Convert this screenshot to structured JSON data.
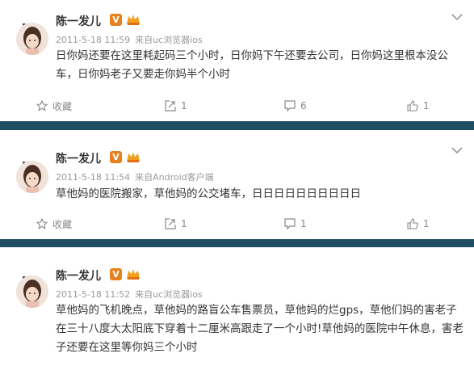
{
  "posts": [
    {
      "author": "陈一发儿",
      "verified_badge": "V",
      "time": "2011-5-18 11:59",
      "source_prefix": "来自",
      "source": "uc浏览器ios",
      "content": "日你妈还要在这里耗起码三个小时，日你妈下午还要去公司，日你妈这里根本没公车，日你妈老子又要走你妈半个小时",
      "favorite_label": "收藏",
      "repost_count": "1",
      "comment_count": "6",
      "like_count": "1"
    },
    {
      "author": "陈一发儿",
      "verified_badge": "V",
      "time": "2011-5-18 11:54",
      "source_prefix": "来自",
      "source": "Android客户端",
      "content": "草他妈的医院搬家，草他妈的公交堵车，日日日日日日日日日日",
      "favorite_label": "收藏",
      "repost_count": "1",
      "comment_count": "1",
      "like_count": "1"
    },
    {
      "author": "陈一发儿",
      "verified_badge": "V",
      "time": "2011-5-18 11:52",
      "source_prefix": "来自",
      "source": "uc浏览器ios",
      "content": "草他妈的飞机晚点，草他妈的路盲公车售票员，草他妈的烂gps，草他们妈的害老子在三十八度大太阳底下穿着十二厘米高跟走了一个小时!草他妈的医院中午休息，害老子还要在这里等你妈三个小时"
    }
  ],
  "colors": {
    "divider": "#1f4e63",
    "verified": "#e8801f",
    "meta": "#999999",
    "text": "#333333"
  },
  "icons": [
    "avatar",
    "verified-badge",
    "member-icon",
    "chevron-down-icon",
    "star-icon",
    "repost-icon",
    "comment-icon",
    "like-icon"
  ]
}
